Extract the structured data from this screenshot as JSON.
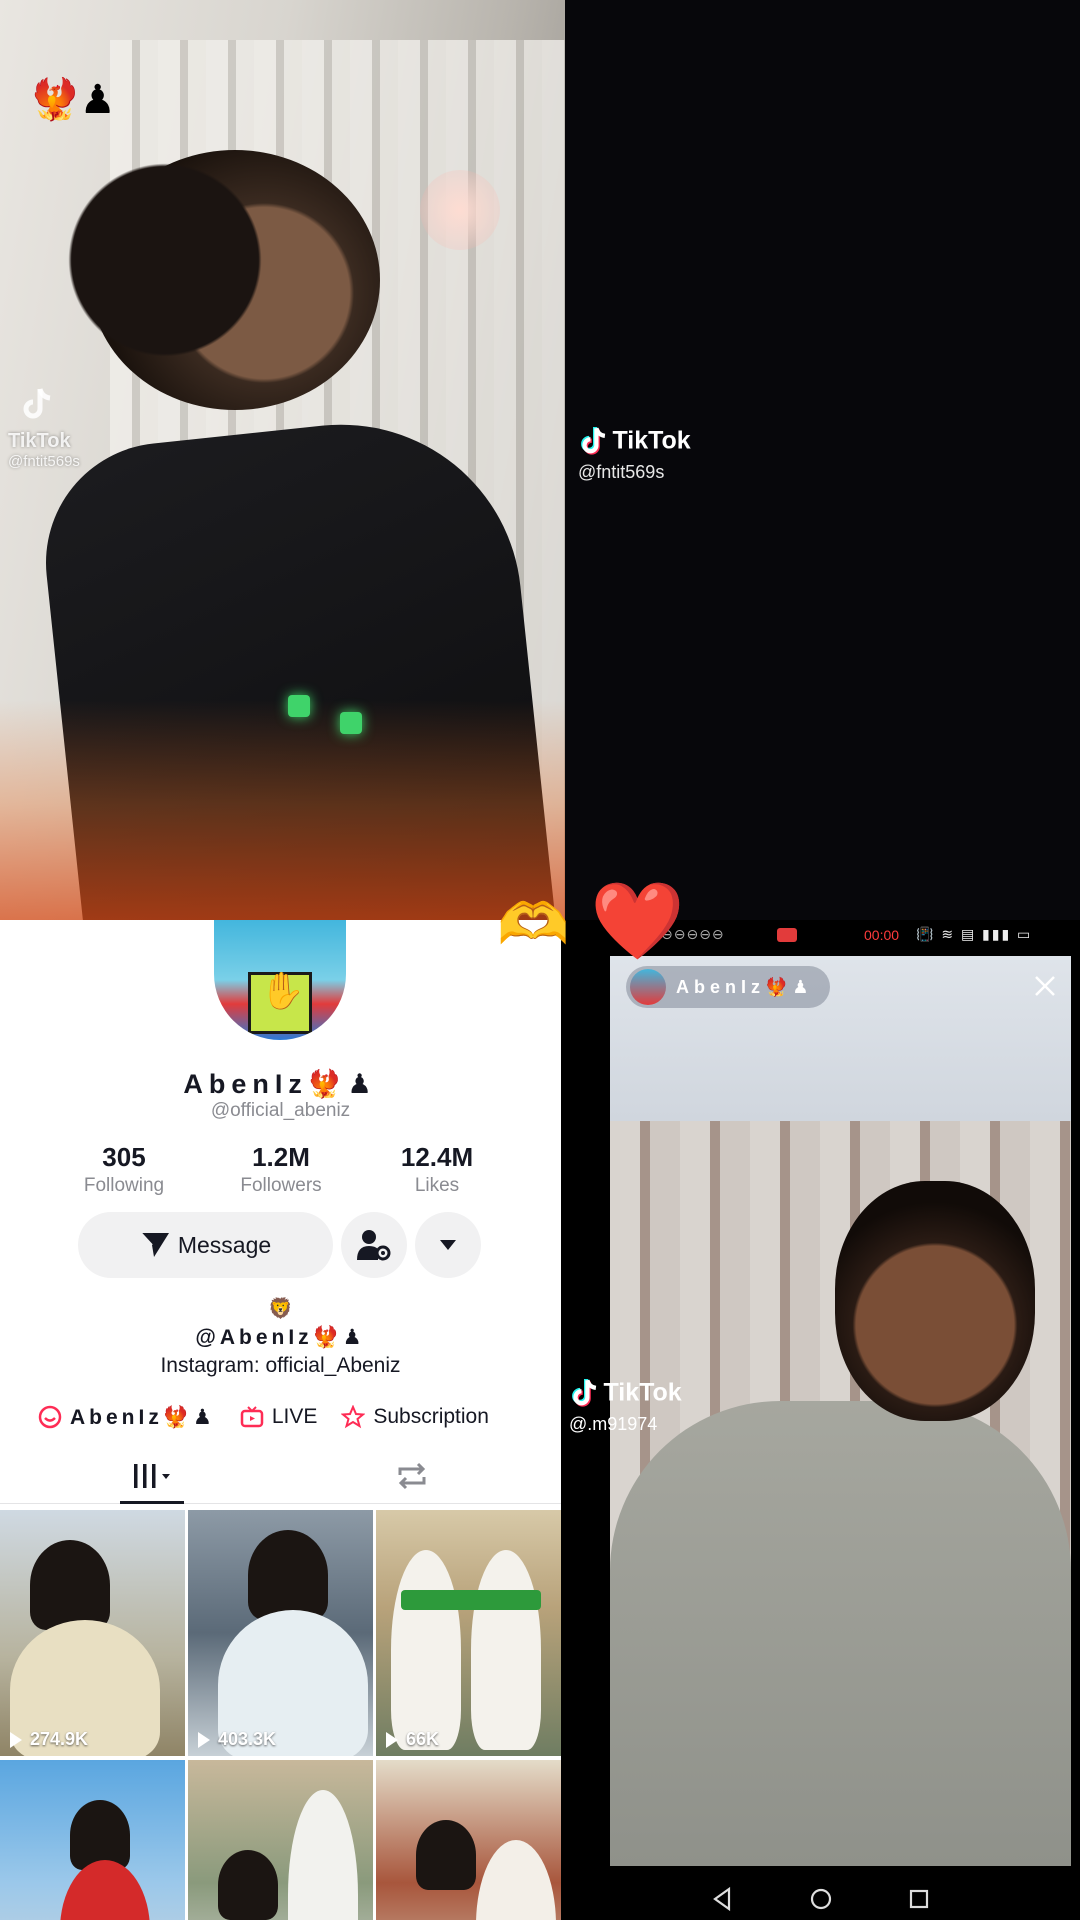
{
  "top_left_video": {
    "emojis": "🐦‍🔥♟",
    "watermark": {
      "title": "TikTok",
      "handle": "@fntit569s"
    }
  },
  "top_right_video": {
    "watermark": {
      "title": "TikTok",
      "handle": "@fntit569s"
    }
  },
  "overlay": {
    "heart_hands": "🫶",
    "red_heart": "❤️"
  },
  "profile": {
    "display_name": "AbenIz🐦‍🔥♟",
    "handle": "@official_abeniz",
    "stats": [
      {
        "value": "305",
        "label": "Following"
      },
      {
        "value": "1.2M",
        "label": "Followers"
      },
      {
        "value": "12.4M",
        "label": "Likes"
      }
    ],
    "message_button": "Message",
    "bio_emoji": "🦁",
    "bio_line1": "@AbenIz🐦‍🔥♟",
    "bio_line2": "Instagram: official_Abeniz",
    "links": {
      "name": "AbenIz🐦‍🔥♟",
      "live": "LIVE",
      "subscription": "Subscription"
    },
    "grid": [
      {
        "views": "274.9K"
      },
      {
        "views": "403.3K"
      },
      {
        "views": "66K"
      },
      {
        "views": ""
      },
      {
        "views": ""
      },
      {
        "views": ""
      }
    ]
  },
  "live_recording": {
    "status_time": "00:00",
    "status_left": "⊖⊖⊖⊖⊖",
    "status_icons": "📳 ≋ ▤ ▮▮▮ ▭",
    "badge_name": "AbenIz🐦‍🔥♟",
    "watermark": {
      "title": "TikTok",
      "handle": "@.m91974"
    }
  },
  "colors": {
    "tiktok_pink": "#fe2c55",
    "tiktok_cyan": "#25f4ee",
    "text_dark": "#161823",
    "text_grey": "#8a8b91"
  }
}
